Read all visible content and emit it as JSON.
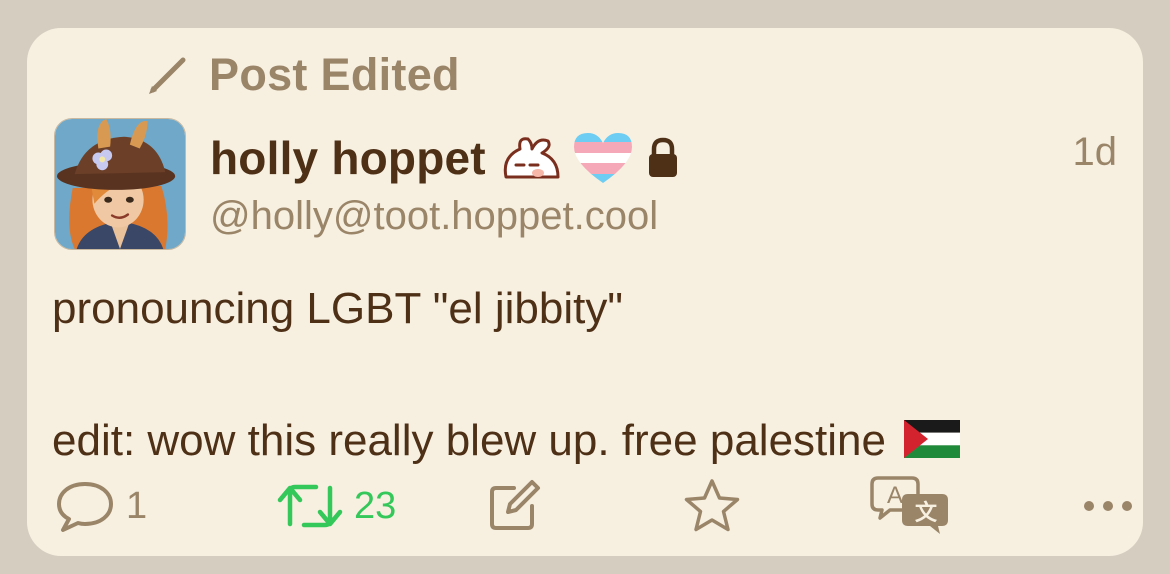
{
  "post": {
    "edited_label": "Post Edited",
    "author": {
      "display_name": "holly hoppet",
      "handle": "@holly@toot.hoppet.cool"
    },
    "timestamp": "1d",
    "content": {
      "line1": "pronouncing LGBT \"el jibbity\"",
      "line2": "edit: wow this really blew up. free palestine"
    },
    "actions": {
      "reply_count": "1",
      "boost_count": "23"
    }
  },
  "colors": {
    "background": "#d5cdbf",
    "card": "#f7f0e1",
    "text": "#4e3017",
    "muted": "#9b8569",
    "boost": "#34c759"
  },
  "icons": {
    "edited": "pencil-icon",
    "emoji1": "bunny-emoji",
    "emoji2": "trans-heart-emoji",
    "locked": "lock-icon",
    "flag": "palestine-flag-emoji",
    "reply": "speech-bubble-icon",
    "boost": "boost-arrows-icon",
    "quote": "compose-icon",
    "favourite": "star-icon",
    "translate": "translate-icon",
    "more": "ellipsis-icon"
  }
}
